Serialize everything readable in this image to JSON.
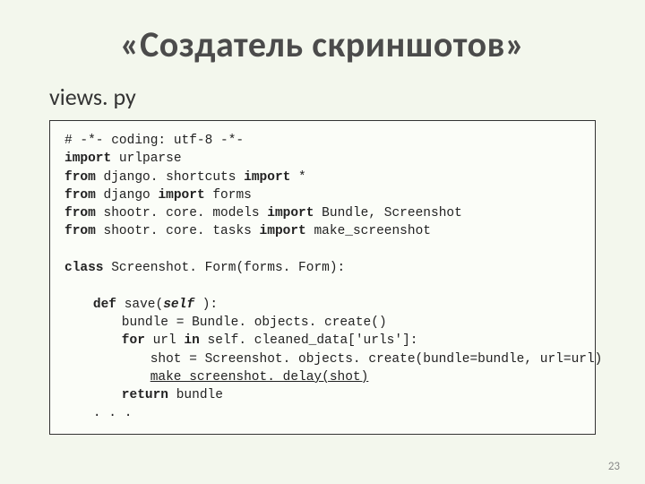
{
  "title": "«Создатель скриншотов»",
  "subtitle": "views. py",
  "page_number": "23",
  "code": {
    "l1a": "# -*- coding: utf-8 -*-",
    "l2a": "import",
    "l2b": " urlparse",
    "l3a": "from",
    "l3b": " django. shortcuts ",
    "l3c": "import",
    "l3d": " *",
    "l4a": "from",
    "l4b": " django ",
    "l4c": "import",
    "l4d": " forms",
    "l5a": "from",
    "l5b": " shootr. core. models ",
    "l5c": "import",
    "l5d": " Bundle, Screenshot",
    "l6a": "from",
    "l6b": " shootr. core. tasks ",
    "l6c": "import",
    "l6d": " make_screenshot",
    "l7a": "class",
    "l7b": " Screenshot. Form(forms. Form):",
    "l8a": "def",
    "l8b": " save(",
    "l8c": "self",
    "l8d": " ):",
    "l9a": "bundle = Bundle. objects. create()",
    "l10a": "for",
    "l10b": " url ",
    "l10c": "in",
    "l10d": " self. cleaned_data['urls']:",
    "l11a": "shot = Screenshot. objects. create(bundle=bundle, url=url)",
    "l12a": "make screenshot. delay(shot)",
    "l13a": "return",
    "l13b": " bundle",
    "l14a": ". . ."
  }
}
